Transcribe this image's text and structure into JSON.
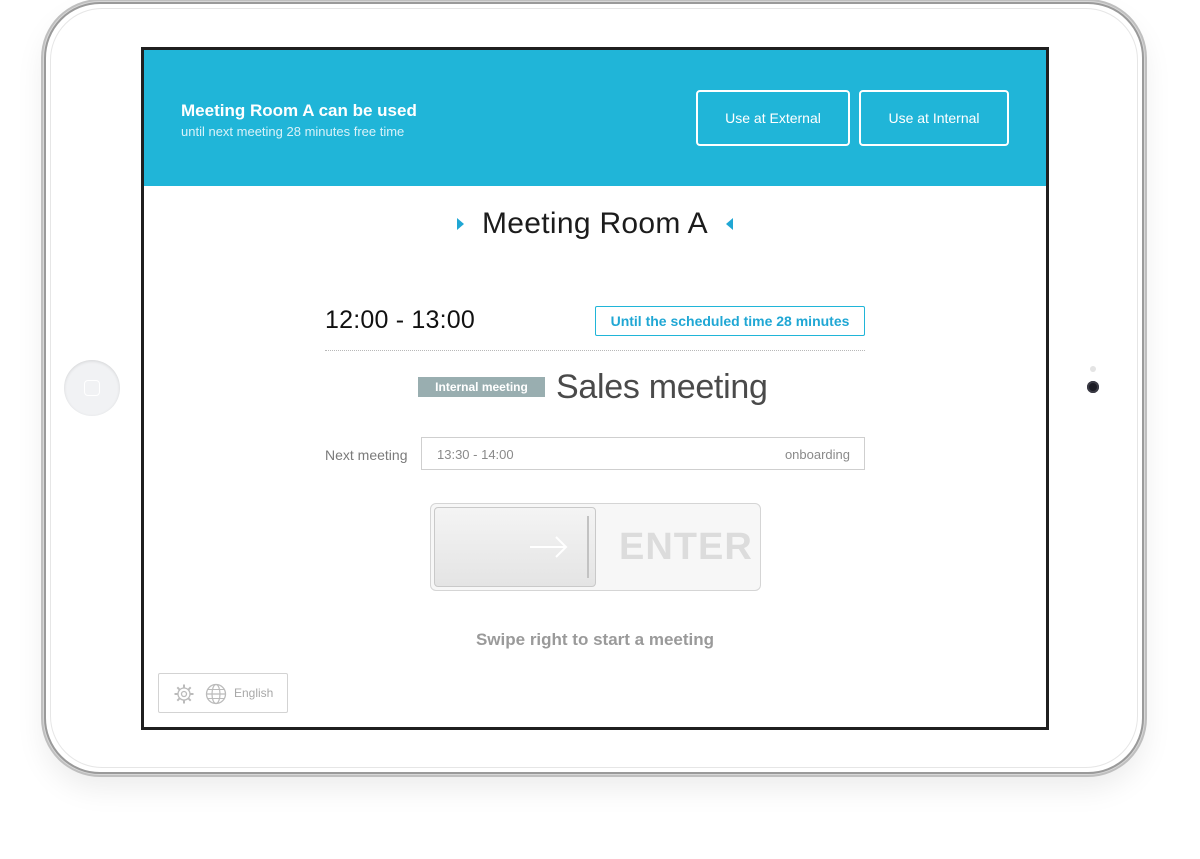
{
  "banner": {
    "title": "Meeting Room A can be used",
    "subtitle": "until next meeting 28 minutes free time",
    "buttons": {
      "external": "Use at External",
      "internal": "Use at Internal"
    },
    "color": "#20b5d8"
  },
  "room": {
    "name": "Meeting Room A"
  },
  "current_meeting": {
    "time": "12:00 - 13:00",
    "countdown": "Until the scheduled time 28 minutes",
    "type_badge": "Internal meeting",
    "title": "Sales meeting"
  },
  "next_meeting": {
    "label": "Next meeting",
    "time": "13:30 - 14:00",
    "title": "onboarding"
  },
  "swipe": {
    "label": "ENTER",
    "hint": "Swipe right to start a meeting"
  },
  "footer": {
    "settings_icon": "gear-icon",
    "language_icon": "globe-icon",
    "language": "English"
  }
}
